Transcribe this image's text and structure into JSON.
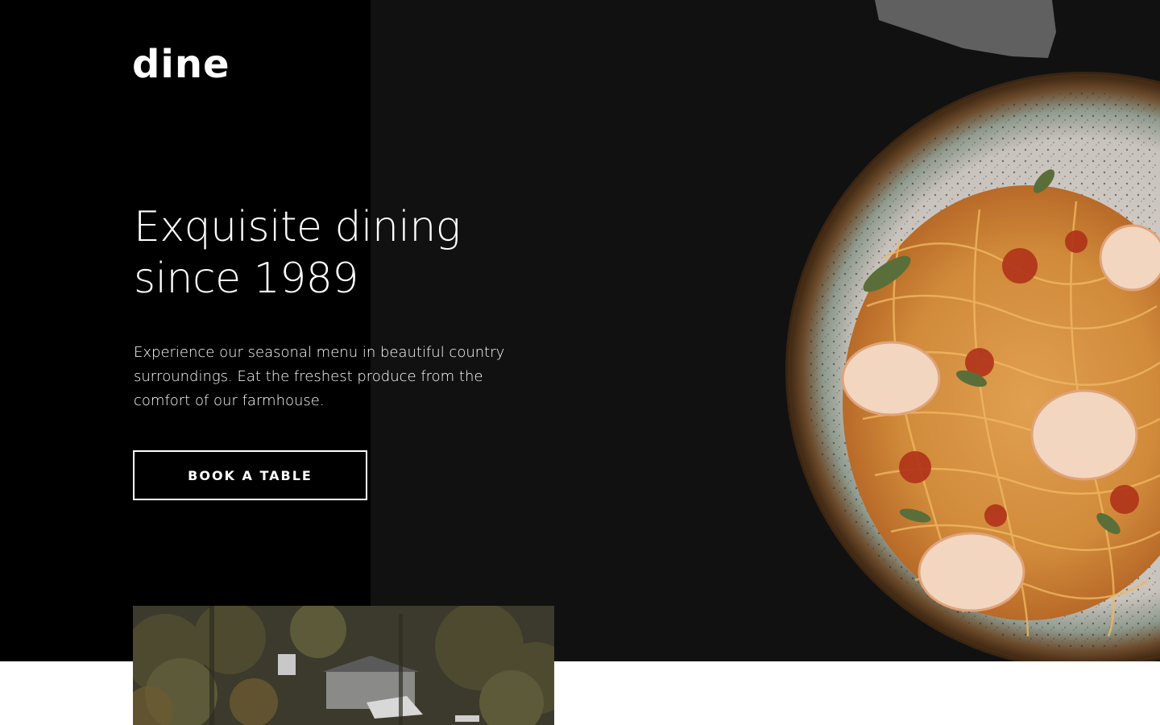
{
  "brand": {
    "logo_text": "dine"
  },
  "hero": {
    "title_line1": "Exquisite dining",
    "title_line2": "since 1989",
    "description": "Experience our seasonal menu in beautiful country surroundings. Eat the freshest produce from the comfort of our farmhouse.",
    "cta_label": "BOOK A TABLE"
  },
  "images": {
    "hero_food": "pasta-with-shrimp-plate-image",
    "farmhouse": "farmhouse-in-forest-image"
  },
  "colors": {
    "hero_background": "#111111",
    "left_panel": "#000000",
    "text": "#ffffff",
    "below_section": "#ffffff"
  }
}
